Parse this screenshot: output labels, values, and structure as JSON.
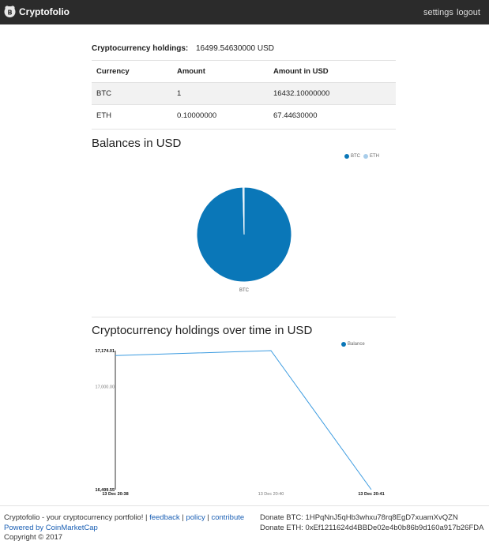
{
  "navbar": {
    "brand": "Cryptofolio",
    "links": [
      "settings",
      "logout"
    ]
  },
  "holdings": {
    "label": "Cryptocurrency holdings:",
    "value": "16499.54630000 USD"
  },
  "table": {
    "headers": [
      "Currency",
      "Amount",
      "Amount in USD"
    ],
    "rows": [
      [
        "BTC",
        "1",
        "16432.10000000"
      ],
      [
        "ETH",
        "0.10000000",
        "67.44630000"
      ]
    ]
  },
  "colors": {
    "btc": "#0a77b8",
    "eth": "#a8cdea",
    "balance_line": "#3b9be0",
    "navbar": "#2b2b2b"
  },
  "pie": {
    "title": "Balances in USD",
    "legend": [
      "BTC",
      "ETH"
    ],
    "slice_label": "BTC"
  },
  "line": {
    "title": "Cryptocurrency holdings over time in USD",
    "legend": "Balance",
    "y_ticks": [
      "17,174.01",
      "17,000.00",
      "16,499.55"
    ],
    "x_ticks": [
      "13 Dec 20:38",
      "13 Dec 20:40",
      "13 Dec 20:41"
    ]
  },
  "chart_data": [
    {
      "type": "pie",
      "title": "Balances in USD",
      "categories": [
        "BTC",
        "ETH"
      ],
      "values": [
        16432.1,
        67.4463
      ],
      "legend": "top-right"
    },
    {
      "type": "line",
      "title": "Cryptocurrency holdings over time in USD",
      "x": [
        "13 Dec 20:38",
        "13 Dec 20:40",
        "13 Dec 20:41"
      ],
      "series": [
        {
          "name": "Balance",
          "values": [
            17150,
            17174.01,
            16499.55
          ]
        }
      ],
      "ylim": [
        16499.55,
        17174.01
      ],
      "yticks": [
        17174.01,
        17000.0,
        16499.55
      ],
      "legend": "top-right"
    }
  ],
  "footer": {
    "text": "Cryptofolio - your cryptocurrency portfolio! |",
    "links": [
      "feedback",
      "policy",
      "contribute"
    ],
    "powered": "Powered by CoinMarketCap",
    "copyright": "Copyright © 2017",
    "donate_btc": "Donate BTC: 1HPqNnJ5qHb3whxu78rq8EgD7xuamXvQZN",
    "donate_eth": "Donate ETH: 0xEf1211624d4BBDe02e4b0b86b9d160a917b26FDA"
  }
}
